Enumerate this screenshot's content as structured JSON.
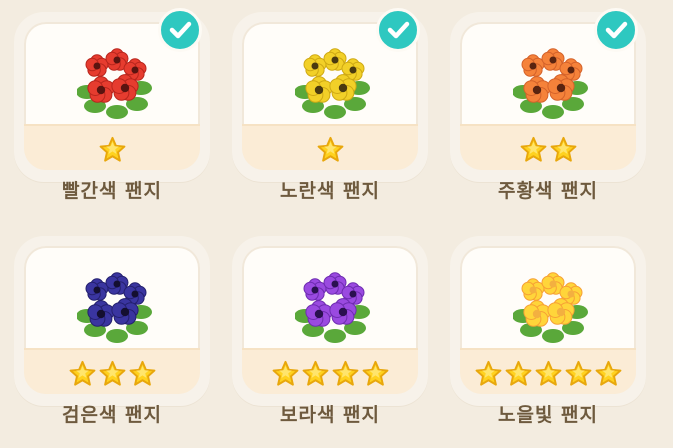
{
  "items": [
    {
      "name": "빨간색 팬지",
      "stars": 1,
      "checked": true,
      "petal": "#e63c2f",
      "petal_dark": "#b8261d",
      "center": "#5a1410"
    },
    {
      "name": "노란색 팬지",
      "stars": 1,
      "checked": true,
      "petal": "#f2d028",
      "petal_dark": "#cfa914",
      "center": "#4a3a10"
    },
    {
      "name": "주황색 팬지",
      "stars": 2,
      "checked": true,
      "petal": "#f5823a",
      "petal_dark": "#d4622a",
      "center": "#5a2410"
    },
    {
      "name": "검은색 팬지",
      "stars": 3,
      "checked": false,
      "petal": "#3a35a0",
      "petal_dark": "#24206e",
      "center": "#140f30"
    },
    {
      "name": "보라색 팬지",
      "stars": 4,
      "checked": false,
      "petal": "#9a4ae0",
      "petal_dark": "#6e2cb0",
      "center": "#2a1050"
    },
    {
      "name": "노을빛 팬지",
      "stars": 5,
      "checked": false,
      "petal": "#ffd53a",
      "petal_dark": "#f7a035",
      "center": "#f3b040"
    }
  ],
  "colors": {
    "check": "#2ec8c0",
    "star": "#ffd21f",
    "star_outline": "#e8a70c",
    "label": "#6e5a3e",
    "leaf": "#5aa83a"
  }
}
